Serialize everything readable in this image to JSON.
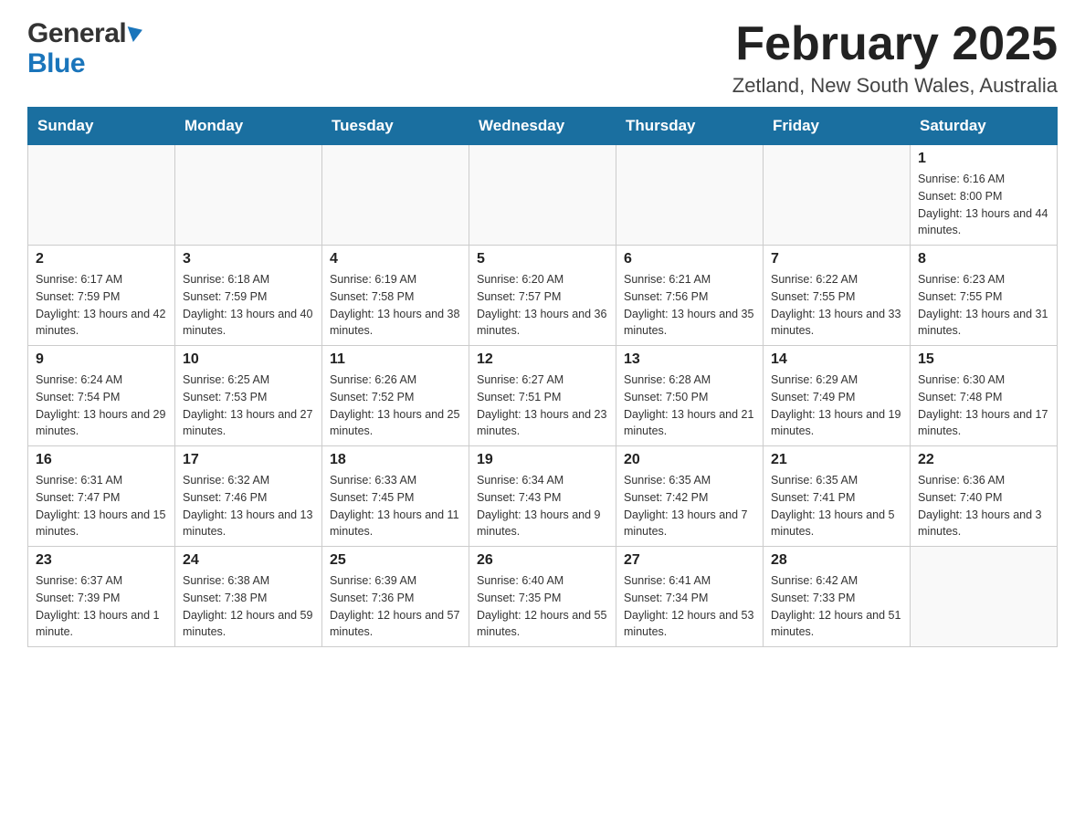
{
  "logo": {
    "general": "General",
    "blue": "Blue",
    "arrow_unicode": "▶"
  },
  "header": {
    "month_year": "February 2025",
    "location": "Zetland, New South Wales, Australia"
  },
  "weekdays": [
    "Sunday",
    "Monday",
    "Tuesday",
    "Wednesday",
    "Thursday",
    "Friday",
    "Saturday"
  ],
  "weeks": [
    [
      {
        "day": "",
        "info": ""
      },
      {
        "day": "",
        "info": ""
      },
      {
        "day": "",
        "info": ""
      },
      {
        "day": "",
        "info": ""
      },
      {
        "day": "",
        "info": ""
      },
      {
        "day": "",
        "info": ""
      },
      {
        "day": "1",
        "info": "Sunrise: 6:16 AM\nSunset: 8:00 PM\nDaylight: 13 hours and 44 minutes."
      }
    ],
    [
      {
        "day": "2",
        "info": "Sunrise: 6:17 AM\nSunset: 7:59 PM\nDaylight: 13 hours and 42 minutes."
      },
      {
        "day": "3",
        "info": "Sunrise: 6:18 AM\nSunset: 7:59 PM\nDaylight: 13 hours and 40 minutes."
      },
      {
        "day": "4",
        "info": "Sunrise: 6:19 AM\nSunset: 7:58 PM\nDaylight: 13 hours and 38 minutes."
      },
      {
        "day": "5",
        "info": "Sunrise: 6:20 AM\nSunset: 7:57 PM\nDaylight: 13 hours and 36 minutes."
      },
      {
        "day": "6",
        "info": "Sunrise: 6:21 AM\nSunset: 7:56 PM\nDaylight: 13 hours and 35 minutes."
      },
      {
        "day": "7",
        "info": "Sunrise: 6:22 AM\nSunset: 7:55 PM\nDaylight: 13 hours and 33 minutes."
      },
      {
        "day": "8",
        "info": "Sunrise: 6:23 AM\nSunset: 7:55 PM\nDaylight: 13 hours and 31 minutes."
      }
    ],
    [
      {
        "day": "9",
        "info": "Sunrise: 6:24 AM\nSunset: 7:54 PM\nDaylight: 13 hours and 29 minutes."
      },
      {
        "day": "10",
        "info": "Sunrise: 6:25 AM\nSunset: 7:53 PM\nDaylight: 13 hours and 27 minutes."
      },
      {
        "day": "11",
        "info": "Sunrise: 6:26 AM\nSunset: 7:52 PM\nDaylight: 13 hours and 25 minutes."
      },
      {
        "day": "12",
        "info": "Sunrise: 6:27 AM\nSunset: 7:51 PM\nDaylight: 13 hours and 23 minutes."
      },
      {
        "day": "13",
        "info": "Sunrise: 6:28 AM\nSunset: 7:50 PM\nDaylight: 13 hours and 21 minutes."
      },
      {
        "day": "14",
        "info": "Sunrise: 6:29 AM\nSunset: 7:49 PM\nDaylight: 13 hours and 19 minutes."
      },
      {
        "day": "15",
        "info": "Sunrise: 6:30 AM\nSunset: 7:48 PM\nDaylight: 13 hours and 17 minutes."
      }
    ],
    [
      {
        "day": "16",
        "info": "Sunrise: 6:31 AM\nSunset: 7:47 PM\nDaylight: 13 hours and 15 minutes."
      },
      {
        "day": "17",
        "info": "Sunrise: 6:32 AM\nSunset: 7:46 PM\nDaylight: 13 hours and 13 minutes."
      },
      {
        "day": "18",
        "info": "Sunrise: 6:33 AM\nSunset: 7:45 PM\nDaylight: 13 hours and 11 minutes."
      },
      {
        "day": "19",
        "info": "Sunrise: 6:34 AM\nSunset: 7:43 PM\nDaylight: 13 hours and 9 minutes."
      },
      {
        "day": "20",
        "info": "Sunrise: 6:35 AM\nSunset: 7:42 PM\nDaylight: 13 hours and 7 minutes."
      },
      {
        "day": "21",
        "info": "Sunrise: 6:35 AM\nSunset: 7:41 PM\nDaylight: 13 hours and 5 minutes."
      },
      {
        "day": "22",
        "info": "Sunrise: 6:36 AM\nSunset: 7:40 PM\nDaylight: 13 hours and 3 minutes."
      }
    ],
    [
      {
        "day": "23",
        "info": "Sunrise: 6:37 AM\nSunset: 7:39 PM\nDaylight: 13 hours and 1 minute."
      },
      {
        "day": "24",
        "info": "Sunrise: 6:38 AM\nSunset: 7:38 PM\nDaylight: 12 hours and 59 minutes."
      },
      {
        "day": "25",
        "info": "Sunrise: 6:39 AM\nSunset: 7:36 PM\nDaylight: 12 hours and 57 minutes."
      },
      {
        "day": "26",
        "info": "Sunrise: 6:40 AM\nSunset: 7:35 PM\nDaylight: 12 hours and 55 minutes."
      },
      {
        "day": "27",
        "info": "Sunrise: 6:41 AM\nSunset: 7:34 PM\nDaylight: 12 hours and 53 minutes."
      },
      {
        "day": "28",
        "info": "Sunrise: 6:42 AM\nSunset: 7:33 PM\nDaylight: 12 hours and 51 minutes."
      },
      {
        "day": "",
        "info": ""
      }
    ]
  ]
}
